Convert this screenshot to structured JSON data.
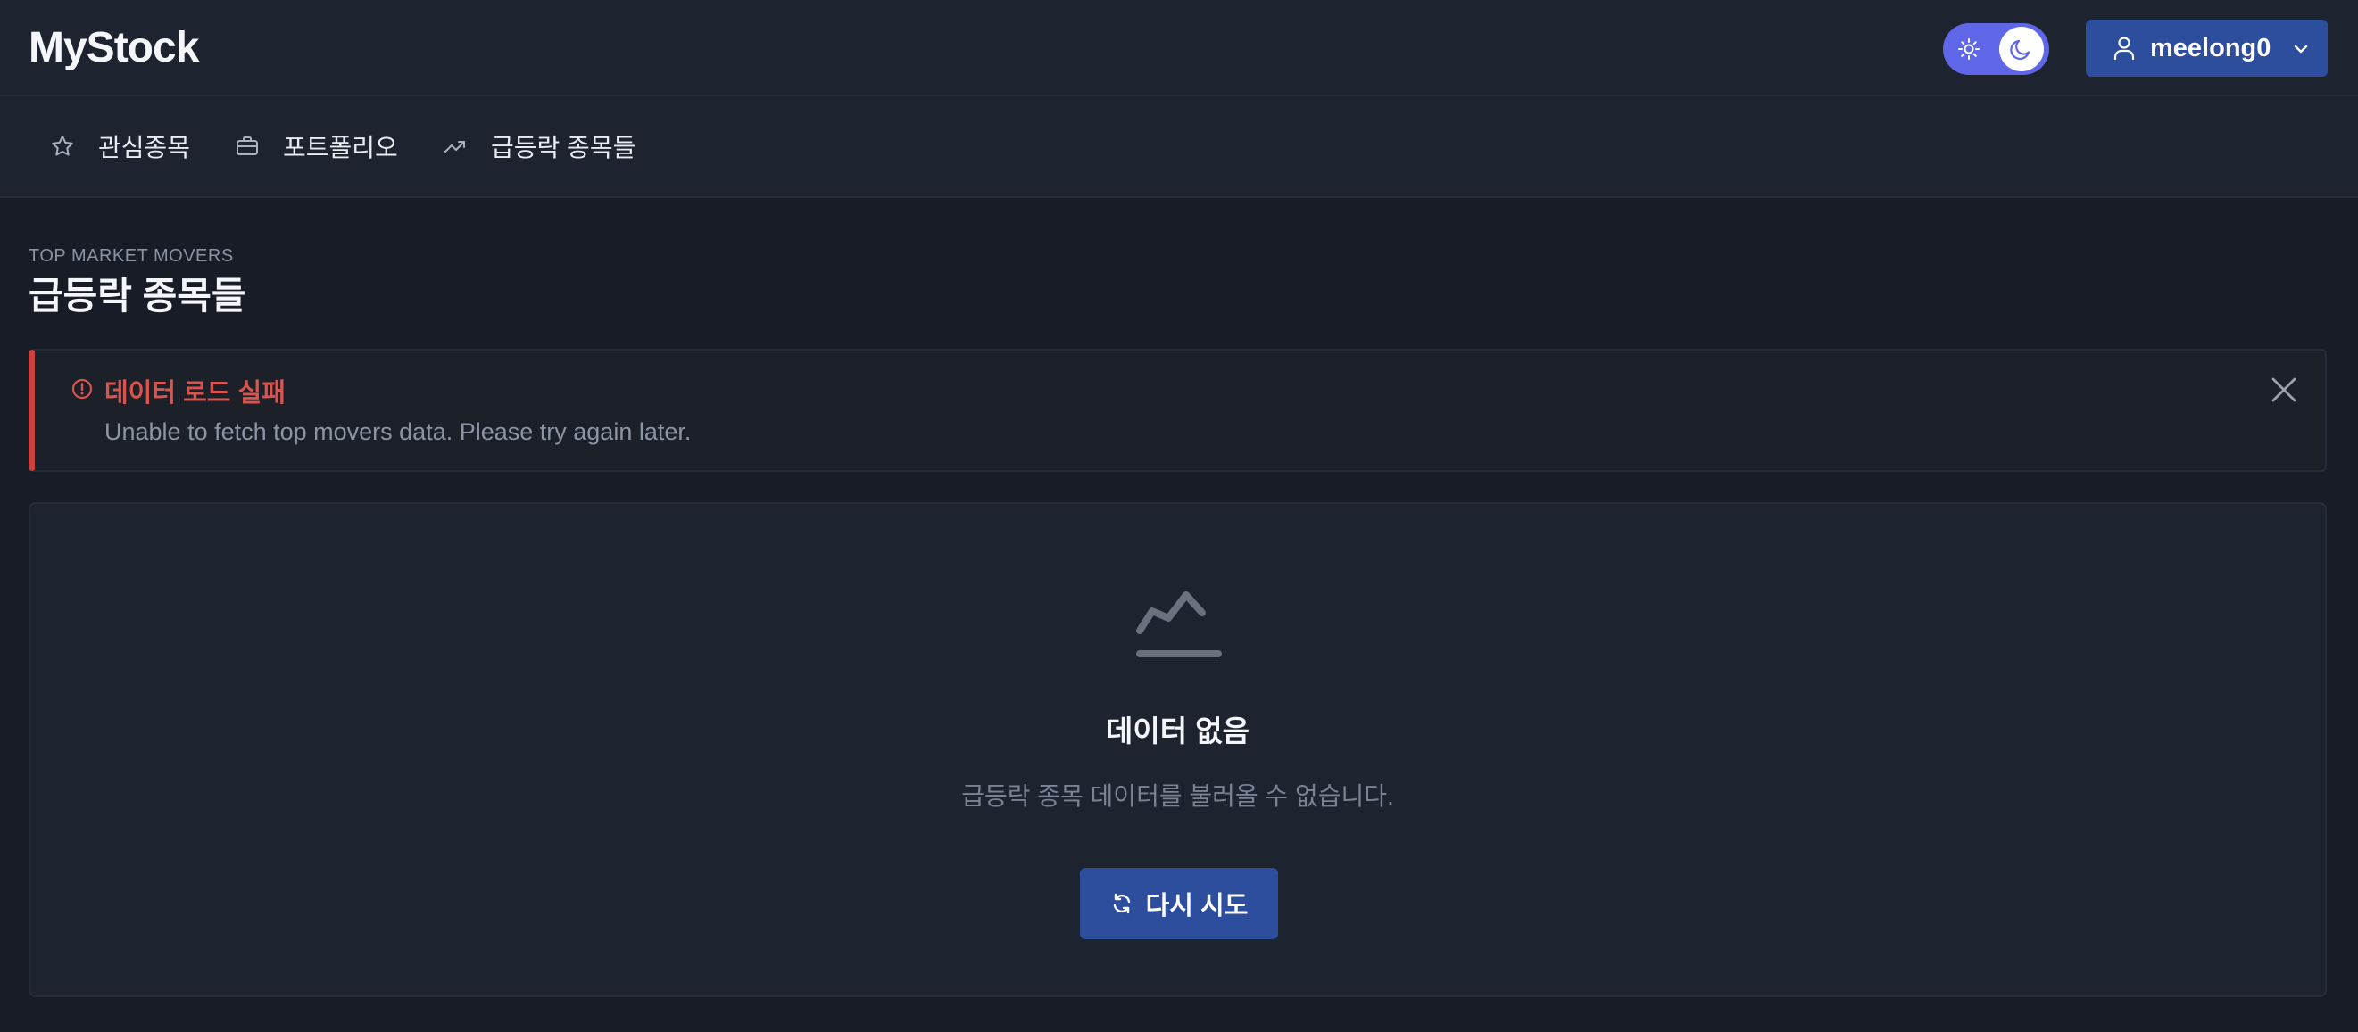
{
  "app": {
    "title": "MyStock"
  },
  "header": {
    "theme_toggle": {
      "mode": "dark",
      "light_icon": "sun-icon",
      "dark_icon": "moon-icon"
    },
    "user": {
      "username": "meelong0",
      "icon": "user-icon",
      "dropdown_icon": "chevron-down-icon"
    }
  },
  "nav": {
    "items": [
      {
        "label": "관심종목",
        "icon": "star-icon"
      },
      {
        "label": "포트폴리오",
        "icon": "briefcase-icon"
      },
      {
        "label": "급등락 종목들",
        "icon": "trending-up-icon"
      }
    ]
  },
  "page": {
    "subtitle": "TOP MARKET MOVERS",
    "title": "급등락 종목들"
  },
  "alert": {
    "icon": "alert-circle-icon",
    "title": "데이터 로드 실패",
    "message": "Unable to fetch top movers data. Please try again later.",
    "close_icon": "close-icon"
  },
  "empty_state": {
    "icon": "chart-area-icon",
    "title": "데이터 없음",
    "description": "급등락 종목 데이터를 불러올 수 없습니다.",
    "retry_label": "다시 시도",
    "retry_icon": "refresh-icon"
  },
  "colors": {
    "background": "#171c26",
    "surface": "#1e2330",
    "primary": "#2c4e9d",
    "toggle": "#5f67e8",
    "error": "#d9534f"
  }
}
